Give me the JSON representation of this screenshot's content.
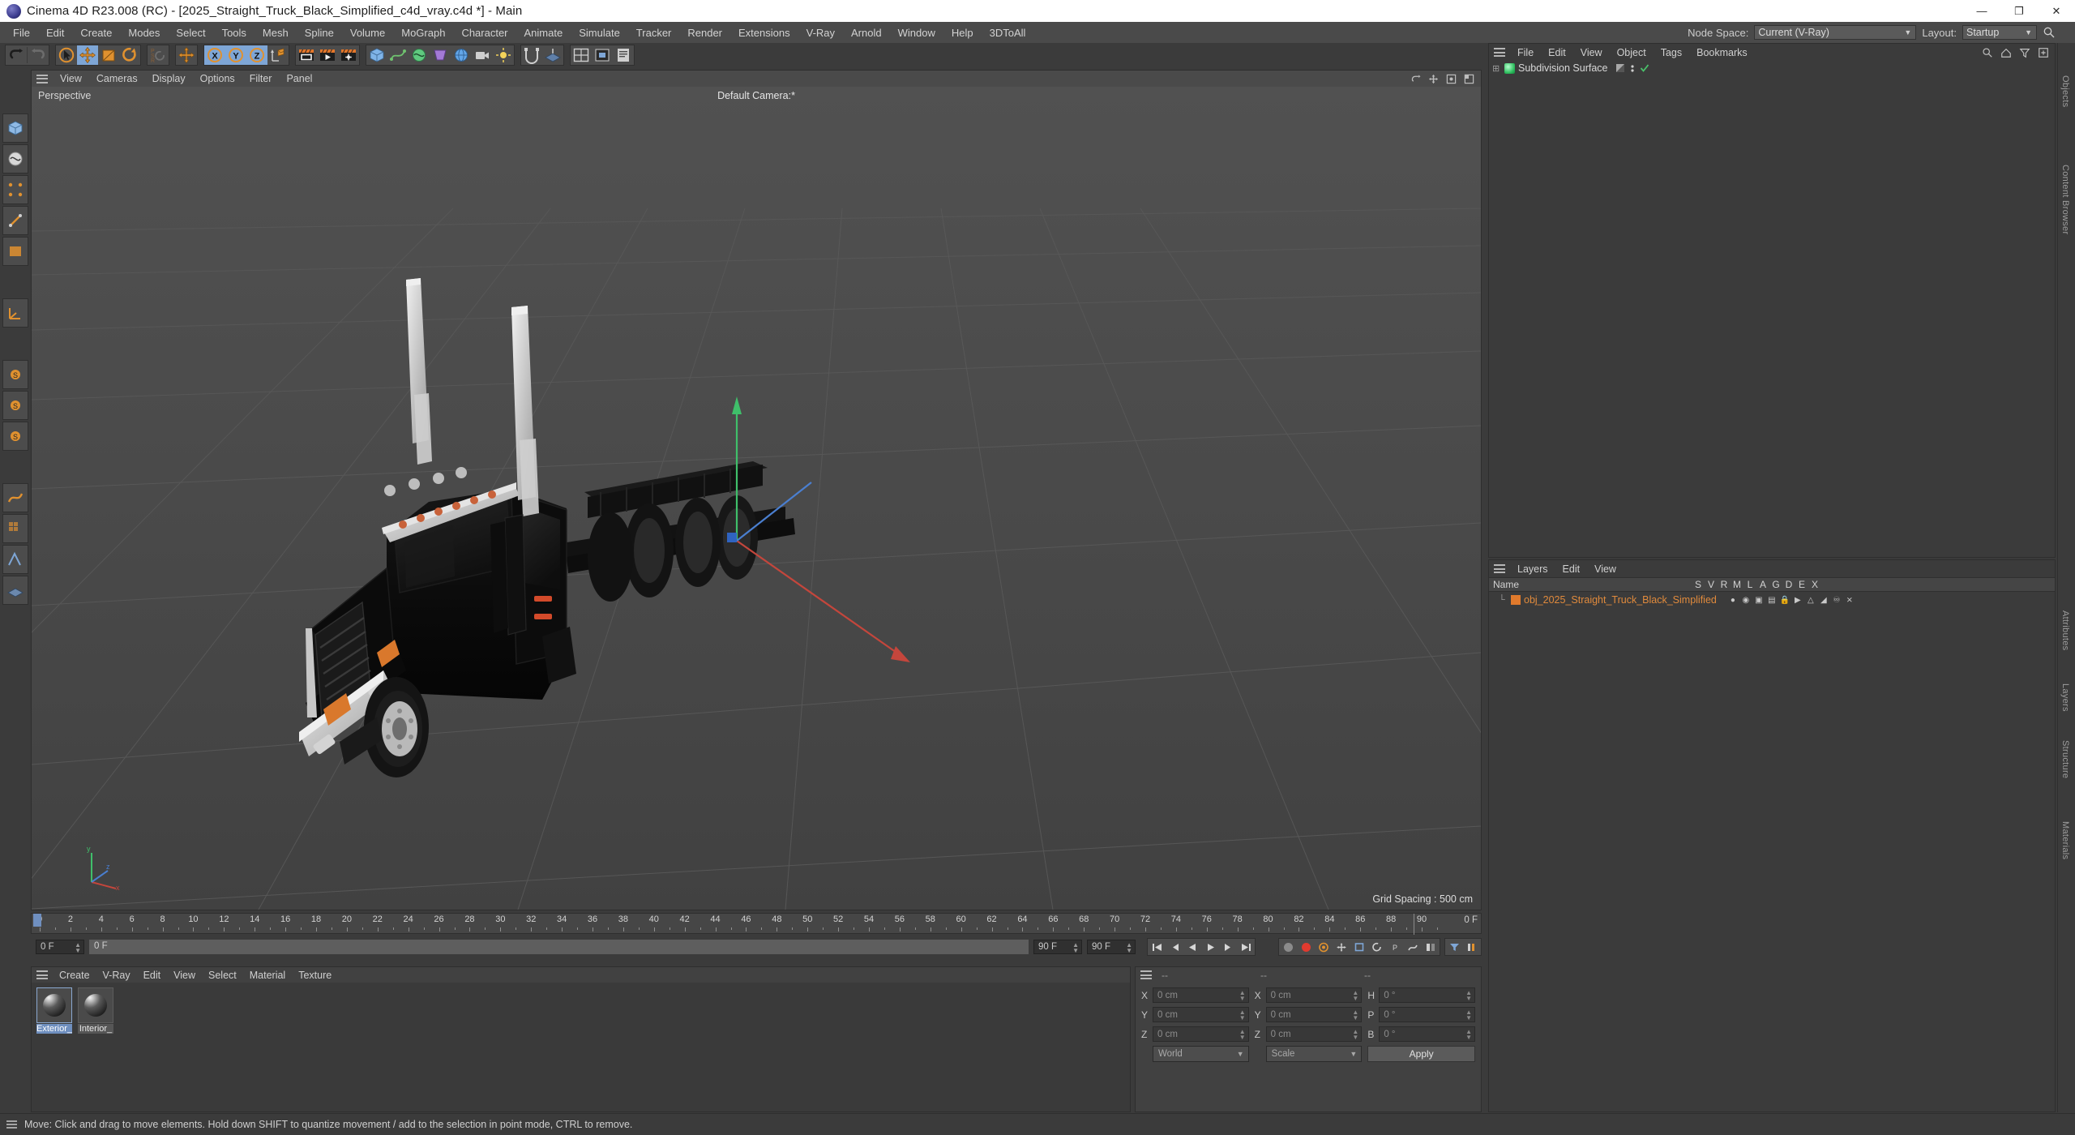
{
  "window": {
    "title": "Cinema 4D R23.008 (RC) - [2025_Straight_Truck_Black_Simplified_c4d_vray.c4d *] - Main",
    "minimize": "—",
    "maximize": "❐",
    "close": "✕"
  },
  "menubar": {
    "items": [
      "File",
      "Edit",
      "Create",
      "Modes",
      "Select",
      "Tools",
      "Mesh",
      "Spline",
      "Volume",
      "MoGraph",
      "Character",
      "Animate",
      "Simulate",
      "Tracker",
      "Render",
      "Extensions",
      "V-Ray",
      "Arnold",
      "Window",
      "Help",
      "3DToAll"
    ]
  },
  "nodespace": {
    "label": "Node Space:",
    "value": "Current (V-Ray)",
    "layout_label": "Layout:",
    "layout_value": "Startup",
    "search_icon": "search-icon"
  },
  "toolbar": {
    "groups": [
      {
        "name": "undo-redo",
        "buttons": [
          {
            "name": "undo-button",
            "icon": "undo-icon",
            "active": false
          },
          {
            "name": "redo-button",
            "icon": "redo-icon",
            "active": false
          }
        ]
      },
      {
        "name": "transform-tools",
        "buttons": [
          {
            "name": "live-selection-button",
            "icon": "cursor-circle-icon",
            "active": false
          },
          {
            "name": "move-tool-button",
            "icon": "move-icon",
            "active": true
          },
          {
            "name": "scale-tool-button",
            "icon": "scale-icon",
            "active": false
          },
          {
            "name": "rotate-tool-button",
            "icon": "rotate-icon",
            "active": false
          }
        ]
      },
      {
        "name": "psr-group",
        "buttons": [
          {
            "name": "psr-button",
            "icon": "psr-icon",
            "active": false
          }
        ]
      },
      {
        "name": "move-group",
        "buttons": [
          {
            "name": "move-duplicate-button",
            "icon": "move-icon",
            "active": false
          }
        ]
      },
      {
        "name": "axis-locks",
        "buttons": [
          {
            "name": "lock-x-button",
            "icon": "x-axis-icon",
            "active": true
          },
          {
            "name": "lock-y-button",
            "icon": "y-axis-icon",
            "active": true
          },
          {
            "name": "lock-z-button",
            "icon": "z-axis-icon",
            "active": true
          },
          {
            "name": "world-object-axis-button",
            "icon": "world-axis-icon",
            "active": false
          }
        ]
      },
      {
        "name": "render-group",
        "buttons": [
          {
            "name": "render-view-button",
            "icon": "render-view-icon",
            "active": false
          },
          {
            "name": "render-queue-button",
            "icon": "render-queue-icon",
            "active": false
          },
          {
            "name": "render-settings-button",
            "icon": "render-settings-icon",
            "active": false
          }
        ]
      },
      {
        "name": "primitives-group",
        "buttons": [
          {
            "name": "add-cube-button",
            "icon": "cube-icon",
            "active": false
          },
          {
            "name": "add-spline-button",
            "icon": "spline-icon",
            "active": false
          },
          {
            "name": "generators-button",
            "icon": "generator-icon",
            "active": false
          },
          {
            "name": "deformers-button",
            "icon": "deformer-icon",
            "active": false
          },
          {
            "name": "environment-button",
            "icon": "environment-icon",
            "active": false
          },
          {
            "name": "camera-button",
            "icon": "camera-icon",
            "active": false
          },
          {
            "name": "light-button",
            "icon": "light-icon",
            "active": false
          }
        ]
      },
      {
        "name": "snap-group",
        "buttons": [
          {
            "name": "snap-button",
            "icon": "snap-icon",
            "active": false
          },
          {
            "name": "workplane-button",
            "icon": "workplane-icon",
            "active": false
          }
        ]
      },
      {
        "name": "view-group",
        "buttons": [
          {
            "name": "viewport-layout-button",
            "icon": "viewport-layout-icon",
            "active": false
          },
          {
            "name": "render-region-button",
            "icon": "render-region-icon",
            "active": false
          },
          {
            "name": "help-button",
            "icon": "help-icon",
            "active": false
          }
        ]
      }
    ]
  },
  "left_toolbar": {
    "buttons": [
      {
        "name": "model-mode-button",
        "icon": "model-mode-icon"
      },
      {
        "name": "texture-mode-button",
        "icon": "texture-mode-icon"
      },
      {
        "name": "point-mode-button",
        "icon": "point-mode-icon"
      },
      {
        "name": "edge-mode-button",
        "icon": "edge-mode-icon"
      },
      {
        "name": "polygon-mode-button",
        "icon": "polygon-mode-icon"
      },
      {
        "name": "axis-mode-button",
        "icon": "axis-mode-icon"
      },
      {
        "name": "enable-axis-button",
        "icon": "enable-axis-icon"
      },
      {
        "name": "viewport-solo-single-button",
        "icon": "solo-single-icon"
      },
      {
        "name": "viewport-solo-hierarchy-button",
        "icon": "solo-hierarchy-icon"
      },
      {
        "name": "viewport-solo-off-button",
        "icon": "solo-off-icon"
      },
      {
        "name": "enable-deformers-button",
        "icon": "deformer-toggle-icon"
      },
      {
        "name": "enable-generators-button",
        "icon": "generator-toggle-icon"
      },
      {
        "name": "enable-snap-button",
        "icon": "snap-toggle-icon"
      },
      {
        "name": "workplane-lock-button",
        "icon": "workplane-lock-icon"
      }
    ]
  },
  "viewport": {
    "menu": [
      "View",
      "Cameras",
      "Display",
      "Options",
      "Filter",
      "Panel"
    ],
    "view_label": "Perspective",
    "camera_label": "Default Camera:*",
    "grid_spacing": "Grid Spacing : 500 cm",
    "corner_icons": [
      "viewport-undo-icon",
      "viewport-move-icon",
      "viewport-fit-icon",
      "viewport-maximize-icon"
    ],
    "axis_gizmo": {
      "x": "x",
      "y": "y",
      "z": "z"
    },
    "scene_object": "black semi truck tractor, 3/4 front-left view"
  },
  "timeline": {
    "ticks": [
      0,
      2,
      4,
      6,
      8,
      10,
      12,
      14,
      16,
      18,
      20,
      22,
      24,
      26,
      28,
      30,
      32,
      34,
      36,
      38,
      40,
      42,
      44,
      46,
      48,
      50,
      52,
      54,
      56,
      58,
      60,
      62,
      64,
      66,
      68,
      70,
      72,
      74,
      76,
      78,
      80,
      82,
      84,
      86,
      88,
      90
    ],
    "current_frame": 0,
    "end_marker": "90",
    "right_label": "0 F"
  },
  "playback": {
    "current_frame_field": "0 F",
    "preview_range_label": "0 F",
    "range_end_field": "90 F",
    "range_end_field2": "90 F",
    "buttons": [
      {
        "name": "go-to-start-button",
        "icon": "skip-start-icon"
      },
      {
        "name": "step-back-button",
        "icon": "step-back-icon"
      },
      {
        "name": "play-backwards-button",
        "icon": "play-back-icon"
      },
      {
        "name": "play-forward-button",
        "icon": "play-icon"
      },
      {
        "name": "step-forward-button",
        "icon": "step-forward-icon"
      },
      {
        "name": "go-to-end-button",
        "icon": "skip-end-icon"
      }
    ],
    "record_buttons": [
      {
        "name": "record-active-objects-button",
        "icon": "record-dot-icon"
      },
      {
        "name": "autokeying-button",
        "icon": "autokey-icon"
      },
      {
        "name": "keyframe-position-button",
        "icon": "key-position-icon"
      },
      {
        "name": "keyframe-scale-button",
        "icon": "key-scale-icon"
      },
      {
        "name": "keyframe-rotation-button",
        "icon": "key-rotation-icon"
      },
      {
        "name": "keyframe-parameter-button",
        "icon": "key-param-icon"
      },
      {
        "name": "keyframe-pla-button",
        "icon": "key-pla-icon"
      },
      {
        "name": "point-level-animation-button",
        "icon": "pla-icon"
      }
    ]
  },
  "material_manager": {
    "menu": [
      "Create",
      "V-Ray",
      "Edit",
      "View",
      "Select",
      "Material",
      "Texture"
    ],
    "materials": [
      {
        "name": "Exterior_",
        "selected": true
      },
      {
        "name": "Interior_",
        "selected": false
      }
    ]
  },
  "coordinates": {
    "header": [
      "--",
      "--",
      "--"
    ],
    "position": {
      "label_x": "X",
      "x": "0 cm",
      "label_y": "Y",
      "y": "0 cm",
      "label_z": "Z",
      "z": "0 cm"
    },
    "size": {
      "label_x": "X",
      "x": "0 cm",
      "label_y": "Y",
      "y": "0 cm",
      "label_z": "Z",
      "z": "0 cm"
    },
    "rotation": {
      "label_h": "H",
      "h": "0 °",
      "label_p": "P",
      "p": "0 °",
      "label_b": "B",
      "b": "0 °"
    },
    "coord_system": "World",
    "transform_mode": "Scale",
    "apply_label": "Apply"
  },
  "object_manager": {
    "menu": [
      "File",
      "Edit",
      "View",
      "Object",
      "Tags",
      "Bookmarks"
    ],
    "header_icons": [
      "search-icon",
      "home-icon",
      "filter-icon",
      "add-icon"
    ],
    "objects": [
      {
        "name": "Subdivision Surface",
        "icon": "subdivision-surface-icon",
        "expandable": true,
        "tags": [
          "display-tag",
          "visibility-tag",
          "check-tag"
        ]
      }
    ],
    "tab_label": "Objects"
  },
  "layers_manager": {
    "menu": [
      "Layers",
      "Edit",
      "View"
    ],
    "columns": [
      "Name",
      "S",
      "V",
      "R",
      "M",
      "L",
      "A",
      "G",
      "D",
      "E",
      "X"
    ],
    "layers": [
      {
        "name": "obj_2025_Straight_Truck_Black_Simplified",
        "color": "#e07a2c",
        "flags": [
          "solo-icon",
          "view-icon",
          "render-icon",
          "manager-icon",
          "lock-icon",
          "animation-icon",
          "generator-icon",
          "deformer-icon",
          "expression-icon",
          "xref-icon"
        ]
      }
    ]
  },
  "vertical_tabs": [
    "Objects",
    "Content Browser",
    "Attributes",
    "Layers",
    "Structure",
    "Materials"
  ],
  "statusbar": {
    "text": "Move: Click and drag to move elements. Hold down SHIFT to quantize movement / add to the selection in point mode, CTRL to remove."
  },
  "colors": {
    "accent_blue": "#7ea6d6",
    "orange": "#e08a3c",
    "panel_bg": "#3b3b3b",
    "viewport_bg": "#4a4a4a",
    "record_red": "#e03a2f",
    "axis_x": "#c4463c",
    "axis_y": "#46b36b",
    "axis_z": "#4a7fd0"
  }
}
